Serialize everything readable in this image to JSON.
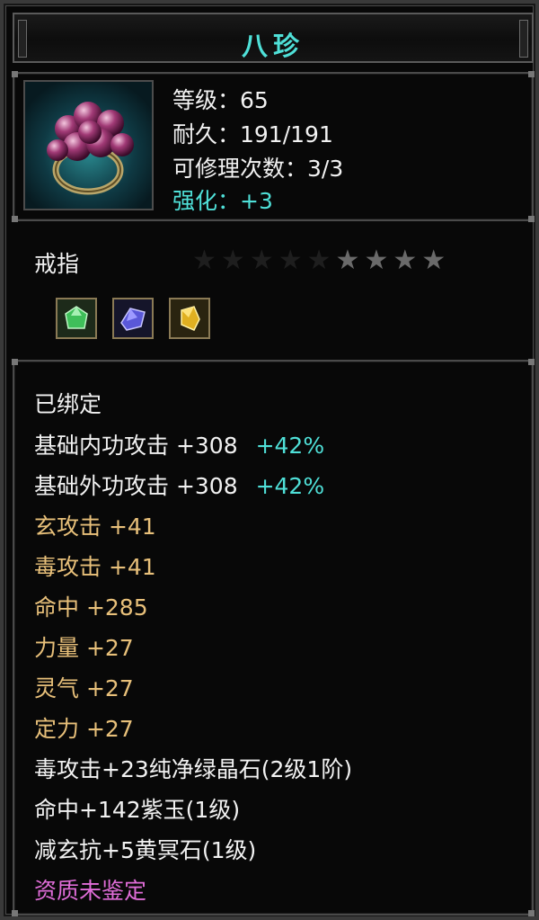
{
  "item": {
    "name": "八珍",
    "level": "等级：65",
    "durability": "耐久：191/191",
    "repair": "可修理次数：3/3",
    "enhance": "强化：+3",
    "type": "戒指",
    "star_rating": {
      "filled": 4,
      "total": 9
    },
    "gems": [
      "green-crystal-gem-icon",
      "purple-jade-gem-icon",
      "yellow-stone-gem-icon"
    ]
  },
  "stats": {
    "bound": "已绑定",
    "inner_attack": "基础内功攻击 +308",
    "inner_attack_bonus": "+42%",
    "outer_attack": "基础外功攻击 +308",
    "outer_attack_bonus": "+42%",
    "mystic_attack": "玄攻击 +41",
    "poison_attack": "毒攻击 +41",
    "accuracy": "命中 +285",
    "strength": "力量 +27",
    "spirit": "灵气 +27",
    "focus": "定力 +27",
    "gem_line_1": "毒攻击+23纯净绿晶石(2级1阶)",
    "gem_line_2": "命中+142紫玉(1级)",
    "gem_line_3": "减玄抗+5黄冥石(1级)",
    "quality": "资质未鉴定"
  },
  "colors": {
    "title": "#4fe0d8",
    "gold": "#e8c07a",
    "cyan": "#4fe0d8",
    "pink": "#e06dd8"
  }
}
